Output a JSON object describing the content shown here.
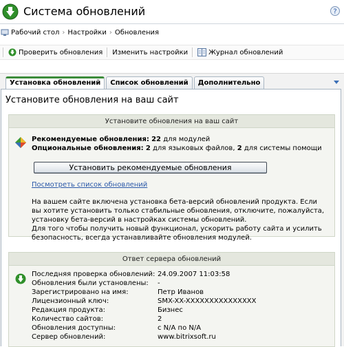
{
  "header": {
    "title": "Система обновлений"
  },
  "breadcrumb": {
    "items": [
      "Рабочий стол",
      "Настройки",
      "Обновления"
    ],
    "separator": "›"
  },
  "toolbar": {
    "check_label": "Проверить обновления",
    "settings_label": "Изменить настройки",
    "log_label": "Журнал обновлений"
  },
  "tabs": [
    "Установка обновлений",
    "Список обновлений",
    "Дополнительно"
  ],
  "main": {
    "title": "Установите обновления на ваш сайт",
    "install_box": {
      "header": "Установите обновления на ваш сайт",
      "recommended_label": "Рекомендуемые обновления:",
      "recommended_count": "22",
      "recommended_suffix": "для модулей",
      "optional_label": "Опциональные обновления:",
      "optional_count_lang": "2",
      "optional_mid": "для языковых файлов,",
      "optional_count_help": "2",
      "optional_suffix": "для системы помощи",
      "install_button": "Установить рекомендуемые обновления",
      "view_list_link": "Посмотреть список обновлений",
      "paragraph1": "На вашем сайте включена установка бета-версий обновлений продукта. Если вы хотите установить только стабильные обновления, отключите, пожалуйста, установку бета-версий в настройках системы обновлений.",
      "paragraph2": "Для того чтобы получить новый функционал, ускорить работу сайта и усилить безопасность, всегда устанавливайте обновления модулей."
    },
    "server_box": {
      "header": "Ответ сервера обновлений",
      "rows": [
        {
          "label": "Последняя проверка обновлений:",
          "value": "24.09.2007 11:03:58"
        },
        {
          "label": "Обновления были установлены:",
          "value": "-"
        },
        {
          "label": "Зарегистрировано на имя:",
          "value": "Петр Иванов"
        },
        {
          "label": "Лицензионный ключ:",
          "value": "SMX-XX-XXXXXXXXXXXXXXX"
        },
        {
          "label": "Редакция продукта:",
          "value": "Бизнес"
        },
        {
          "label": "Количество сайтов:",
          "value": "2"
        },
        {
          "label": "Обновления доступны:",
          "value": "с N/A по N/A"
        },
        {
          "label": "Сервер обновлений:",
          "value": "www.bitrixsoft.ru"
        }
      ]
    }
  },
  "icons": {
    "logo": "green-update-arrow-icon",
    "help": "help-icon",
    "home": "home-icon",
    "check": "check-updates-icon",
    "log": "journal-icon",
    "recommended": "update-package-icon",
    "server": "server-update-icon"
  },
  "colors": {
    "accent_green": "#3c8c3a",
    "link_blue": "#2a58a8",
    "box_bg": "#f4f5f1"
  }
}
